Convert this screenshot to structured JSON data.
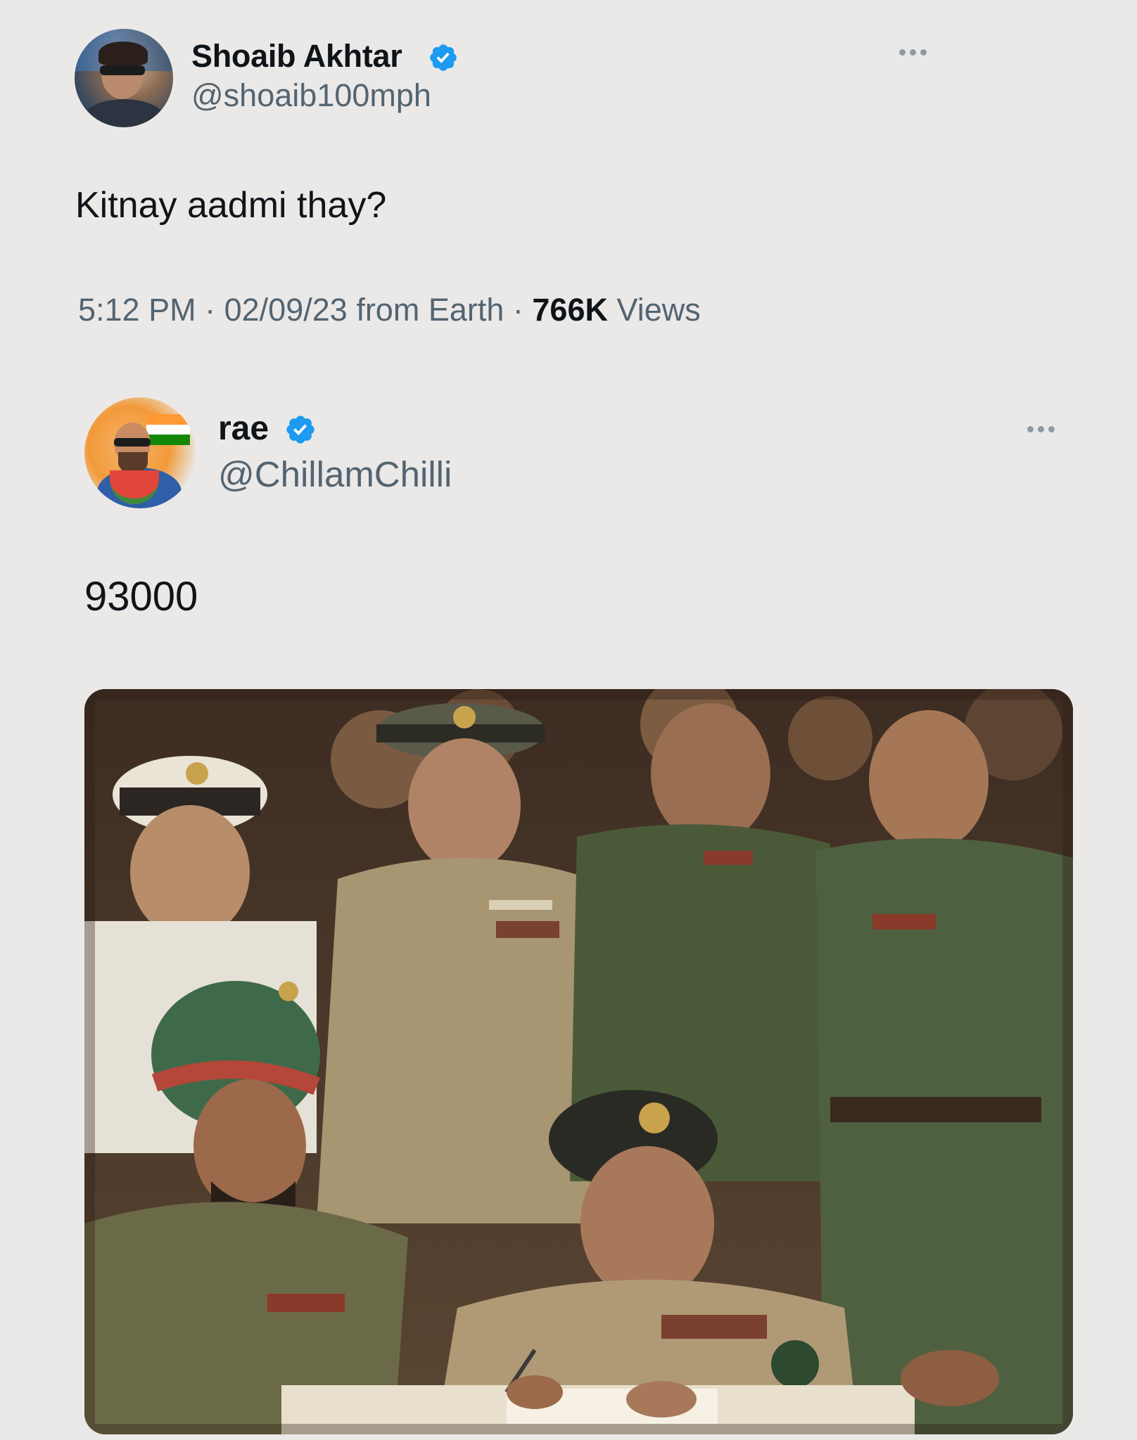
{
  "tweet": {
    "author_name": "Shoaib Akhtar",
    "author_handle": "@shoaib100mph",
    "text": "Kitnay aadmi thay?",
    "time": "5:12 PM",
    "date": "02/09/23",
    "source": "from Earth",
    "separator": "·",
    "views_count": "766K",
    "views_label": "Views"
  },
  "reply": {
    "author_name": "rae",
    "author_handle": "@ChillamChilli",
    "text": "93000"
  },
  "colors": {
    "background": "#ebe9e8",
    "verified_blue": "#1d9bf0",
    "secondary_text": "#536471",
    "primary_text": "#0f1419"
  },
  "icons": {
    "verified": "verified-badge-icon",
    "more": "more-options-icon"
  }
}
